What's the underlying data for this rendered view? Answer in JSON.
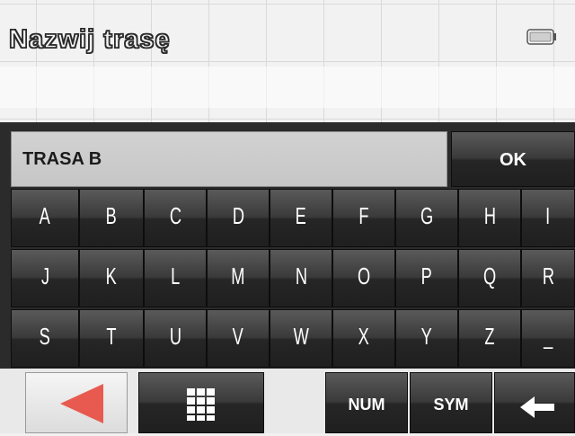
{
  "header": {
    "title": "Nazwij trasę",
    "battery_icon": "battery-icon"
  },
  "input": {
    "value": "TRASA B"
  },
  "keys": {
    "ok_label": "OK",
    "row1": [
      "A",
      "B",
      "C",
      "D",
      "E",
      "F",
      "G",
      "H",
      "I"
    ],
    "row2": [
      "J",
      "K",
      "L",
      "M",
      "N",
      "O",
      "P",
      "Q",
      "R"
    ],
    "row3": [
      "S",
      "T",
      "U",
      "V",
      "W",
      "X",
      "Y",
      "Z",
      "_"
    ],
    "num_label": "NUM",
    "sym_label": "SYM",
    "back_icon": "triangle-left-icon",
    "grid_icon": "keypad-grid-icon",
    "backspace_icon": "arrow-left-icon"
  },
  "colors": {
    "back_triangle": "#e85a4f",
    "key_dark": "#2b2b2b",
    "key_text": "#ffffff"
  }
}
